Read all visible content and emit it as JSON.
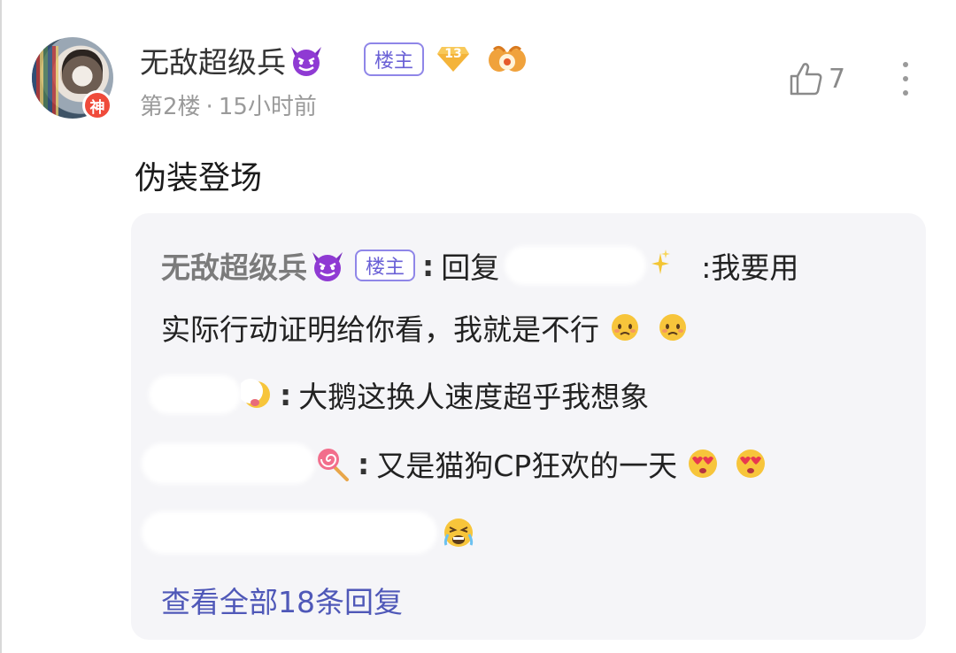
{
  "comment": {
    "username": "无敌超级兵",
    "op_tag": "楼主",
    "level": "13",
    "avatar_badge": "神",
    "floor": "第2楼",
    "time": "15小时前",
    "likes": "7",
    "text": "伪装登场"
  },
  "replies": {
    "line1": {
      "name": "无敌超级兵",
      "op_tag": "楼主",
      "colon": ":",
      "reply_word": "回复",
      "text": ":我要用"
    },
    "line2": {
      "text": "实际行动证明给你看，我就是不行"
    },
    "line3": {
      "colon": ":",
      "text": "大鹅这换人速度超乎我想象"
    },
    "line4": {
      "colon": ":",
      "text": "又是猫狗CP狂欢的一天"
    },
    "view_all": "查看全部18条回复"
  },
  "colors": {
    "accent": "#6a60d6",
    "link": "#4f58b8",
    "panel_bg": "#f5f5f8",
    "badge_red": "#ef4b3b"
  },
  "icons": [
    "devil-emoji-icon",
    "level-diamond-icon",
    "gesture-icon",
    "thumbs-up-icon",
    "more-vertical-icon",
    "sparkle-icon",
    "worried-emoji-icon",
    "lollipop-icon",
    "heart-eyes-emoji-icon",
    "crying-emoji-icon"
  ]
}
